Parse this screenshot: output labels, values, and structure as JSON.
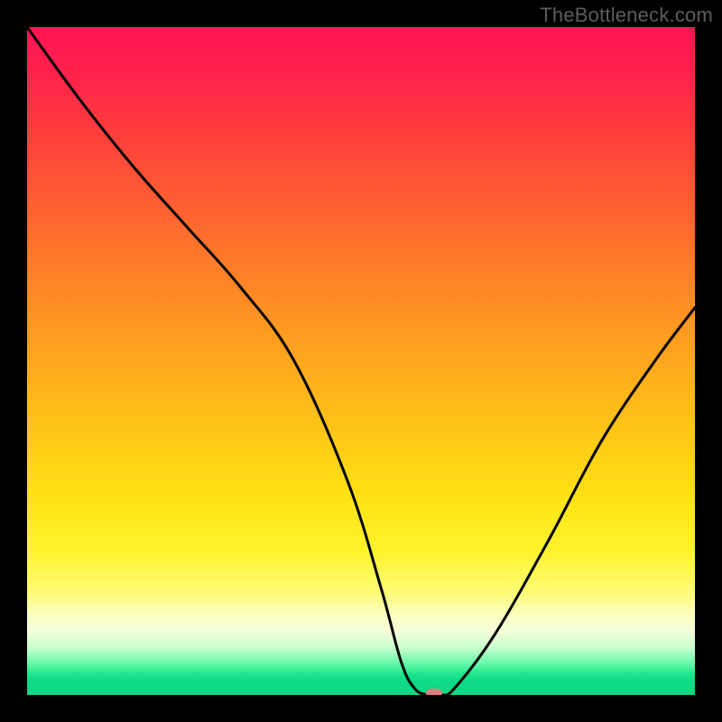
{
  "watermark": "TheBottleneck.com",
  "chart_data": {
    "type": "line",
    "title": "",
    "xlabel": "",
    "ylabel": "",
    "xlim": [
      0,
      100
    ],
    "ylim": [
      0,
      100
    ],
    "background": "heatmap-gradient-red-to-green",
    "series": [
      {
        "name": "bottleneck-curve",
        "x": [
          0,
          8,
          16,
          24,
          32,
          40,
          48,
          53,
          56,
          58,
          60,
          62,
          64,
          70,
          78,
          86,
          94,
          100
        ],
        "y": [
          100,
          89,
          79,
          70,
          61,
          50,
          32,
          16,
          5,
          1,
          0,
          0,
          1,
          9,
          23,
          38,
          50,
          58
        ]
      }
    ],
    "marker": {
      "x": 61,
      "y": 0,
      "color": "#d88083"
    },
    "colors": {
      "curve": "#000000",
      "marker": "#d88083",
      "frame": "#000000"
    }
  }
}
